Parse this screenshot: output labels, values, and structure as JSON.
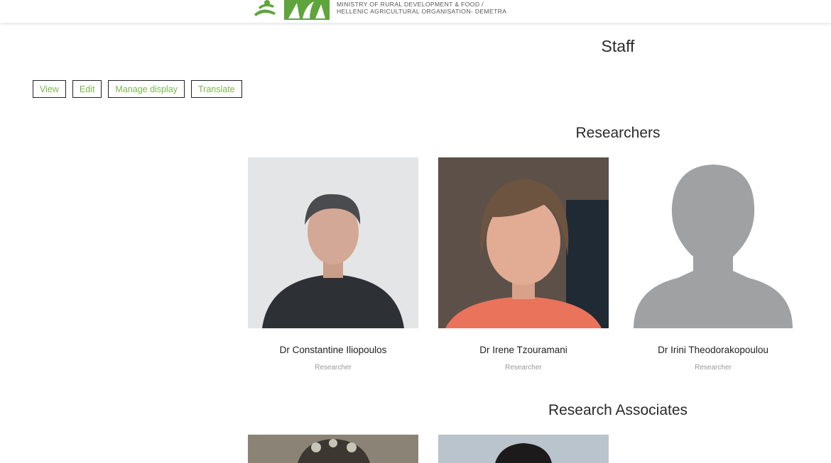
{
  "header": {
    "ministry_line1": "MINISTRY OF RURAL DEVELOPMENT & FOOD /",
    "ministry_line2": "HELLENIC AGRICULTURAL ORGANISATION- DEMETRA",
    "logo_color": "#5fa43c"
  },
  "page": {
    "title": "Staff"
  },
  "tabs": [
    {
      "label": "View"
    },
    {
      "label": "Edit"
    },
    {
      "label": "Manage display"
    },
    {
      "label": "Translate"
    }
  ],
  "sections": {
    "researchers": {
      "title": "Researchers",
      "people": [
        {
          "name": "Dr Constantine Iliopoulos",
          "role": "Researcher"
        },
        {
          "name": "Dr Irene Tzouramani",
          "role": "Researcher"
        },
        {
          "name": "Dr Irini Theodorakopoulou",
          "role": "Researcher"
        }
      ]
    },
    "associates": {
      "title": "Research Associates"
    }
  },
  "colors": {
    "accent_green": "#7ab648",
    "tab_border": "#222222"
  }
}
